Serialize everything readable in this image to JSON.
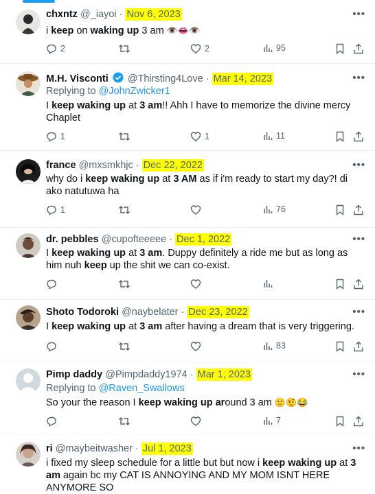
{
  "tweets": [
    {
      "name": "chxntz",
      "handle": "@_iayoi",
      "date": "Nov 6, 2023",
      "body_parts": [
        [
          "i ",
          false
        ],
        [
          "keep",
          true
        ],
        [
          " on ",
          false
        ],
        [
          "waking up",
          true
        ],
        [
          " 3 am ",
          false
        ]
      ],
      "emojis": "👁️👄👁️",
      "replies": "2",
      "retweets": "",
      "likes": "2",
      "views": "95"
    },
    {
      "name": "M.H. Visconti",
      "handle": "@Thirsting4Love",
      "date": "Mar 14, 2023",
      "replying_label": "Replying to",
      "replying_to": "@JohnZwicker1",
      "body_parts": [
        [
          "I ",
          false
        ],
        [
          "keep waking up",
          true
        ],
        [
          " at ",
          false
        ],
        [
          "3 am",
          true
        ],
        [
          "!! Ahh I have to memorize the divine mercy Chaplet",
          false
        ]
      ],
      "replies": "1",
      "retweets": "",
      "likes": "1",
      "views": "11"
    },
    {
      "name": "france",
      "handle": "@mxsmkhjc",
      "date": "Dec 22, 2022",
      "body_parts": [
        [
          "why do i ",
          false
        ],
        [
          "keep waking up",
          true
        ],
        [
          " at ",
          false
        ],
        [
          "3 AM",
          true
        ],
        [
          " as if i'm ready to start my day?! di ako natutuwa ha",
          false
        ]
      ],
      "replies": "1",
      "retweets": "",
      "likes": "",
      "views": "76"
    },
    {
      "name": "dr. pebbles",
      "handle": "@cupofteeeee",
      "date": "Dec 1, 2022",
      "body_parts": [
        [
          "I ",
          false
        ],
        [
          "keep waking up",
          true
        ],
        [
          " at ",
          false
        ],
        [
          "3 am",
          true
        ],
        [
          ". Duppy definitely a ride me but as long as him nuh ",
          false
        ],
        [
          "keep",
          true
        ],
        [
          " up the shit we can co-exist.",
          false
        ]
      ],
      "replies": "",
      "retweets": "",
      "likes": "",
      "views": ""
    },
    {
      "name": "Shoto Todoroki",
      "handle": "@naybelater",
      "date": "Dec 23, 2022",
      "body_parts": [
        [
          "I ",
          false
        ],
        [
          "keep waking up",
          true
        ],
        [
          " at ",
          false
        ],
        [
          "3 am",
          true
        ],
        [
          " after having a dream that is very triggering.",
          false
        ]
      ],
      "replies": "",
      "retweets": "",
      "likes": "",
      "views": "83"
    },
    {
      "name": "Pimp daddy",
      "handle": "@Pimpdaddy1974",
      "date": "Mar 1, 2023",
      "replying_label": "Replying to",
      "replying_to": "@Raven_Swallows",
      "body_parts": [
        [
          "So your the reason I ",
          false
        ],
        [
          "keep waking up ar",
          true
        ],
        [
          "ound 3 am ",
          false
        ]
      ],
      "emojis": "🙁🤨😂",
      "replies": "",
      "retweets": "",
      "likes": "",
      "views": "7"
    },
    {
      "name": "ri",
      "handle": "@maybeitwasher",
      "date": "Jul 1, 2023",
      "body_parts": [
        [
          "i fixed my sleep schedule for a little but but now i ",
          false
        ],
        [
          "keep waking up",
          true
        ],
        [
          " at ",
          false
        ],
        [
          "3 am",
          true
        ],
        [
          " again bc my CAT IS ANNOYING AND MY MOM ISNT HERE ANYMORE SO",
          false
        ]
      ]
    }
  ],
  "separator": "·",
  "colors": {
    "highlight": "#ffff00",
    "link": "#1d9bf0",
    "muted": "#536471",
    "text": "#0f1419"
  }
}
